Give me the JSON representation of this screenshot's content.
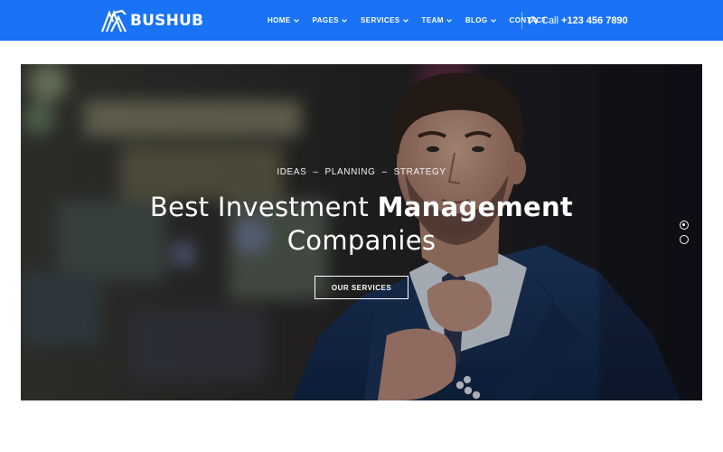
{
  "brand": {
    "name": "BUSHUB"
  },
  "colors": {
    "header_bg": "#1a73f5",
    "text_on_header": "#ffffff"
  },
  "nav": {
    "items": [
      {
        "label": "HOME",
        "has_dropdown": true
      },
      {
        "label": "PAGES",
        "has_dropdown": true
      },
      {
        "label": "SERVICES",
        "has_dropdown": true
      },
      {
        "label": "TEAM",
        "has_dropdown": true
      },
      {
        "label": "BLOG",
        "has_dropdown": true
      },
      {
        "label": "CONTACT",
        "has_dropdown": false
      }
    ]
  },
  "phone": {
    "label": "Call",
    "number": "+123 456 7890",
    "icon": "headset-icon"
  },
  "hero": {
    "tagline": [
      "IDEAS",
      "PLANNING",
      "STRATEGY"
    ],
    "tagline_separator": "–",
    "title_regular": "Best Investment ",
    "title_bold": "Management",
    "title_line2": "Companies",
    "cta_label": "OUR SERVICES",
    "slider": {
      "slides": 2,
      "active_index": 0
    }
  }
}
